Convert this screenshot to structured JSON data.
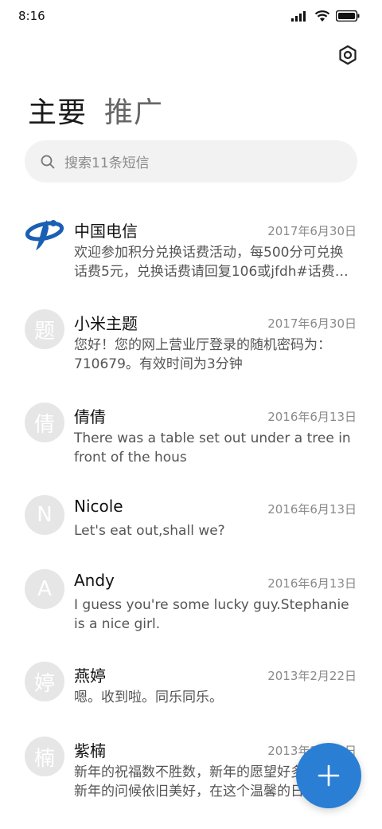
{
  "status_bar": {
    "time": "8:16"
  },
  "tabs": [
    {
      "label": "主要",
      "active": true
    },
    {
      "label": "推广",
      "active": false
    }
  ],
  "search": {
    "placeholder": "搜索11条短信"
  },
  "conversations": [
    {
      "name": "中国电信",
      "date": "2017年6月30日",
      "avatar": "telecom-logo",
      "preview": "欢迎参加积分兑换话费活动，每500分可兑换话费5元，兑换话费请回复106或jfdh#话费…"
    },
    {
      "name": "小米主题",
      "date": "2017年6月30日",
      "avatar": "题",
      "preview": "您好！您的网上营业厅登录的随机密码为：710679。有效时间为3分钟"
    },
    {
      "name": "倩倩",
      "date": "2016年6月13日",
      "avatar": "倩",
      "preview": "There was a table set out under a tree in front of the hous"
    },
    {
      "name": "Nicole",
      "date": "2016年6月13日",
      "avatar": "N",
      "preview": "Let's eat out,shall we?"
    },
    {
      "name": "Andy",
      "date": "2016年6月13日",
      "avatar": "A",
      "preview": "I guess you're some lucky guy.Stephanie is a nice girl."
    },
    {
      "name": "燕婷",
      "date": "2013年2月22日",
      "avatar": "婷",
      "preview": "嗯。收到啦。同乐同乐。"
    },
    {
      "name": "紫楠",
      "date": "2013年2月22日",
      "avatar": "楠",
      "preview": "新年的祝福数不胜数，新年的愿望好多好多，新年的问候依旧美好，在这个温馨的日子里"
    }
  ],
  "colors": {
    "accent": "#2a7fd4",
    "avatar_bg": "#e6e6e6",
    "search_bg": "#f2f2f2"
  },
  "icons": {
    "settings": "gear-icon",
    "search": "search-icon",
    "compose": "plus-icon"
  }
}
